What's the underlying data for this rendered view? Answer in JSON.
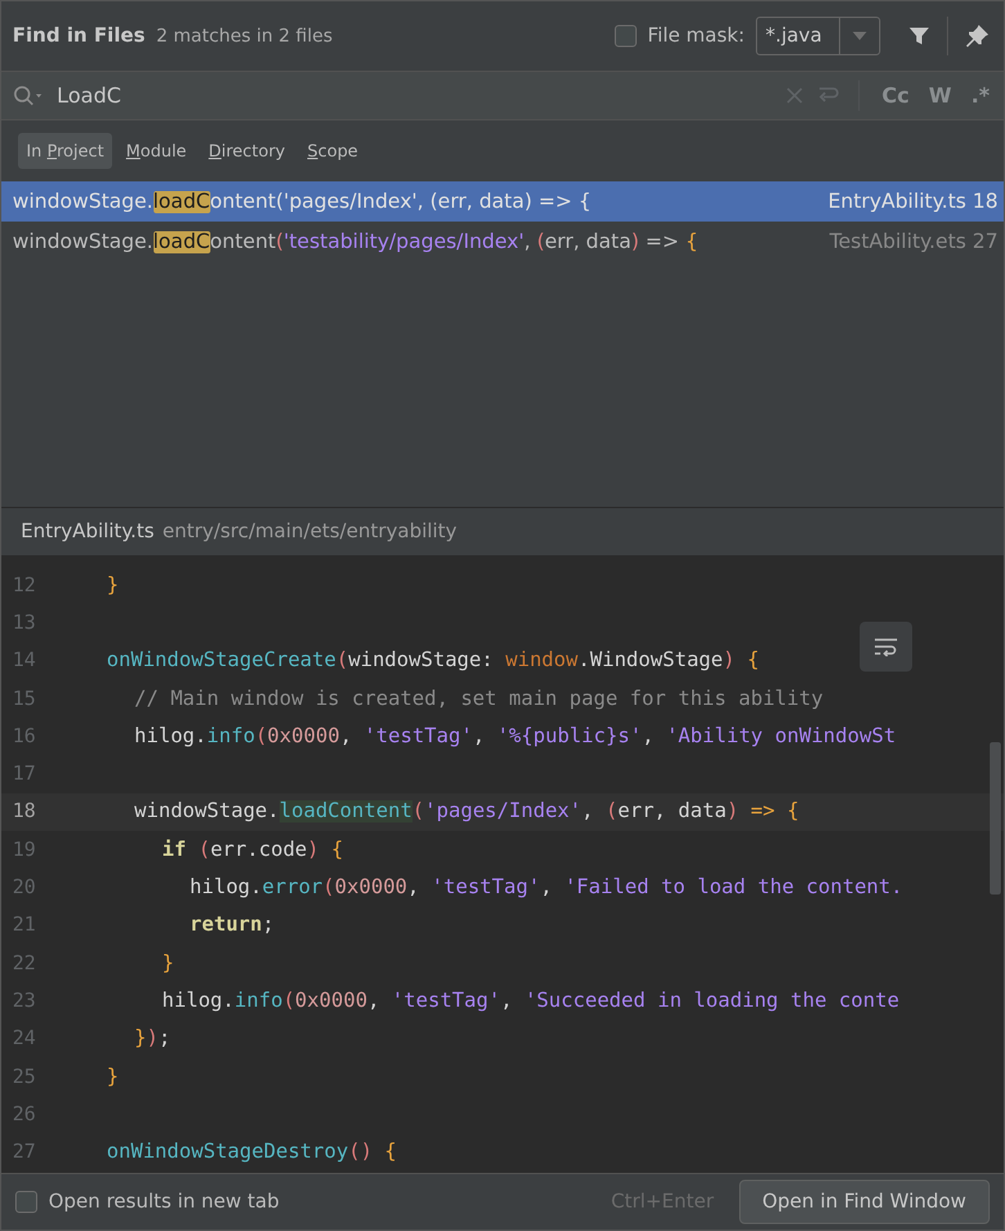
{
  "header": {
    "title": "Find in Files",
    "summary": "2 matches in 2 files",
    "file_mask": {
      "label": "File mask:",
      "checked": false,
      "value": "*.java"
    }
  },
  "search": {
    "value": "LoadC",
    "toggles": [
      {
        "label": "Cc",
        "selected": false
      },
      {
        "label": "W",
        "selected": false
      },
      {
        "label": ".*",
        "selected": false
      }
    ]
  },
  "scopes": [
    {
      "before": "In ",
      "mnemonic": "P",
      "after": "roject",
      "selected": true
    },
    {
      "mnemonic": "M",
      "after": "odule",
      "selected": false
    },
    {
      "mnemonic": "D",
      "after": "irectory",
      "selected": false
    },
    {
      "mnemonic": "S",
      "after": "cope",
      "selected": false
    }
  ],
  "results": [
    {
      "selected": true,
      "prefix": "windowStage.",
      "match": "loadC",
      "rest": "ontent('pages/Index', (err, data) => {",
      "file": "EntryAbility.ts 18"
    },
    {
      "selected": false,
      "prefix": "windowStage.",
      "match": "loadC",
      "rest": [
        {
          "kind": "plain",
          "text": "ontent"
        },
        {
          "kind": "paren",
          "text": "("
        },
        {
          "kind": "str",
          "text": "'testability/pages/Index'"
        },
        {
          "kind": "plain",
          "text": ", "
        },
        {
          "kind": "paren",
          "text": "("
        },
        {
          "kind": "plain",
          "text": "err, data"
        },
        {
          "kind": "paren",
          "text": ")"
        },
        {
          "kind": "plain",
          "text": " => "
        },
        {
          "kind": "brace",
          "text": "{"
        }
      ],
      "file": "TestAbility.ets 27"
    }
  ],
  "preview": {
    "file": "EntryAbility.ts",
    "path": "entry/src/main/ets/entryability",
    "lines": [
      {
        "number": "12",
        "current": false,
        "tokens": [
          {
            "kind": "brace",
            "text": "}"
          }
        ]
      },
      {
        "number": "13",
        "current": false
      },
      {
        "number": "14",
        "current": false,
        "tokens": [
          {
            "kind": "fn",
            "text": "onWindowStageCreate"
          },
          {
            "kind": "paren",
            "text": "("
          },
          {
            "kind": "plain",
            "text": "windowStage: "
          },
          {
            "kind": "type",
            "text": "window"
          },
          {
            "kind": "plain",
            "text": ".WindowStage"
          },
          {
            "kind": "paren",
            "text": ")"
          },
          {
            "kind": "brace",
            "text": " {"
          }
        ],
        "children": [
          {
            "number": "15",
            "current": false,
            "tokens": [
              {
                "kind": "comment",
                "text": "// Main window is created, set main page for this ability"
              }
            ]
          },
          {
            "number": "16",
            "current": false,
            "tokens": [
              {
                "kind": "plain",
                "text": "hilog."
              },
              {
                "kind": "fn",
                "text": "info"
              },
              {
                "kind": "paren",
                "text": "("
              },
              {
                "kind": "num",
                "text": "0x0000"
              },
              {
                "kind": "plain",
                "text": ", "
              },
              {
                "kind": "str",
                "text": "'testTag'"
              },
              {
                "kind": "plain",
                "text": ", "
              },
              {
                "kind": "str",
                "text": "'%{public}s'"
              },
              {
                "kind": "plain",
                "text": ", "
              },
              {
                "kind": "str",
                "text": "'Ability onWindowSt"
              }
            ]
          },
          {
            "number": "17",
            "current": false
          },
          {
            "number": "18",
            "current": true,
            "tokens": [
              {
                "kind": "plain",
                "text": "windowStage."
              },
              {
                "kind": "match",
                "text": "loadContent"
              },
              {
                "kind": "paren",
                "text": "("
              },
              {
                "kind": "str",
                "text": "'pages/Index'"
              },
              {
                "kind": "plain",
                "text": ", "
              },
              {
                "kind": "paren",
                "text": "("
              },
              {
                "kind": "plain",
                "text": "err, data"
              },
              {
                "kind": "paren",
                "text": ")"
              },
              {
                "kind": "brace",
                "text": " => {"
              }
            ],
            "children": [
              {
                "number": "19",
                "current": false,
                "tokens": [
                  {
                    "kind": "kw",
                    "text": "if"
                  },
                  {
                    "kind": "paren",
                    "text": " ("
                  },
                  {
                    "kind": "plain",
                    "text": "err.code"
                  },
                  {
                    "kind": "paren",
                    "text": ")"
                  },
                  {
                    "kind": "brace",
                    "text": " {"
                  }
                ],
                "children": [
                  {
                    "number": "20",
                    "current": false,
                    "tokens": [
                      {
                        "kind": "plain",
                        "text": "hilog."
                      },
                      {
                        "kind": "fn",
                        "text": "error"
                      },
                      {
                        "kind": "paren",
                        "text": "("
                      },
                      {
                        "kind": "num",
                        "text": "0x0000"
                      },
                      {
                        "kind": "plain",
                        "text": ", "
                      },
                      {
                        "kind": "str",
                        "text": "'testTag'"
                      },
                      {
                        "kind": "plain",
                        "text": ", "
                      },
                      {
                        "kind": "str",
                        "text": "'Failed to load the content."
                      }
                    ]
                  },
                  {
                    "number": "21",
                    "current": false,
                    "tokens": [
                      {
                        "kind": "kw",
                        "text": "return"
                      },
                      {
                        "kind": "plain",
                        "text": ";"
                      }
                    ]
                  }
                ]
              },
              {
                "number": "22",
                "current": false,
                "tokens": [
                  {
                    "kind": "brace",
                    "text": "}"
                  }
                ]
              },
              {
                "number": "23",
                "current": false,
                "tokens": [
                  {
                    "kind": "plain",
                    "text": "hilog."
                  },
                  {
                    "kind": "fn",
                    "text": "info"
                  },
                  {
                    "kind": "paren",
                    "text": "("
                  },
                  {
                    "kind": "num",
                    "text": "0x0000"
                  },
                  {
                    "kind": "plain",
                    "text": ", "
                  },
                  {
                    "kind": "str",
                    "text": "'testTag'"
                  },
                  {
                    "kind": "plain",
                    "text": ", "
                  },
                  {
                    "kind": "str",
                    "text": "'Succeeded in loading the conte"
                  }
                ]
              }
            ]
          },
          {
            "number": "24",
            "current": false,
            "tokens": [
              {
                "kind": "brace",
                "text": "}"
              },
              {
                "kind": "paren",
                "text": ")"
              },
              {
                "kind": "plain",
                "text": ";"
              }
            ]
          }
        ]
      },
      {
        "number": "25",
        "current": false,
        "tokens": [
          {
            "kind": "brace",
            "text": "}"
          }
        ]
      },
      {
        "number": "26",
        "current": false
      },
      {
        "number": "27",
        "current": false,
        "tokens": [
          {
            "kind": "fn",
            "text": "onWindowStageDestroy"
          },
          {
            "kind": "paren",
            "text": "()"
          },
          {
            "kind": "brace",
            "text": " {"
          }
        ]
      }
    ]
  },
  "footer": {
    "new_tab": {
      "label": "Open results in new tab",
      "checked": false
    },
    "shortcut": "Ctrl+Enter",
    "button": "Open in Find Window"
  }
}
